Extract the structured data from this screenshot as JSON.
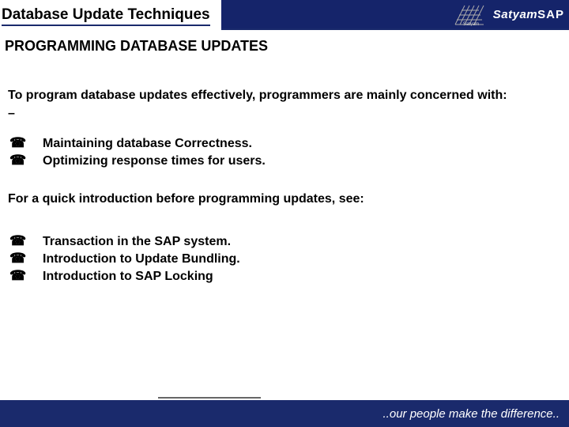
{
  "header": {
    "title": "Database Update Techniques",
    "brand_italic": "Satyam",
    "brand_sap": "SAP"
  },
  "subtitle": "PROGRAMMING DATABASE UPDATES",
  "intro": "To program database updates effectively, programmers are mainly concerned with:",
  "bullets1": [
    "Maintaining database Correctness.",
    "Optimizing response times for users."
  ],
  "see_also": "For a quick introduction before programming updates, see:",
  "bullets2": [
    "Transaction in the SAP system.",
    "Introduction to Update Bundling.",
    "Introduction to SAP Locking"
  ],
  "footer": {
    "tagline": "..our people make the difference.."
  }
}
